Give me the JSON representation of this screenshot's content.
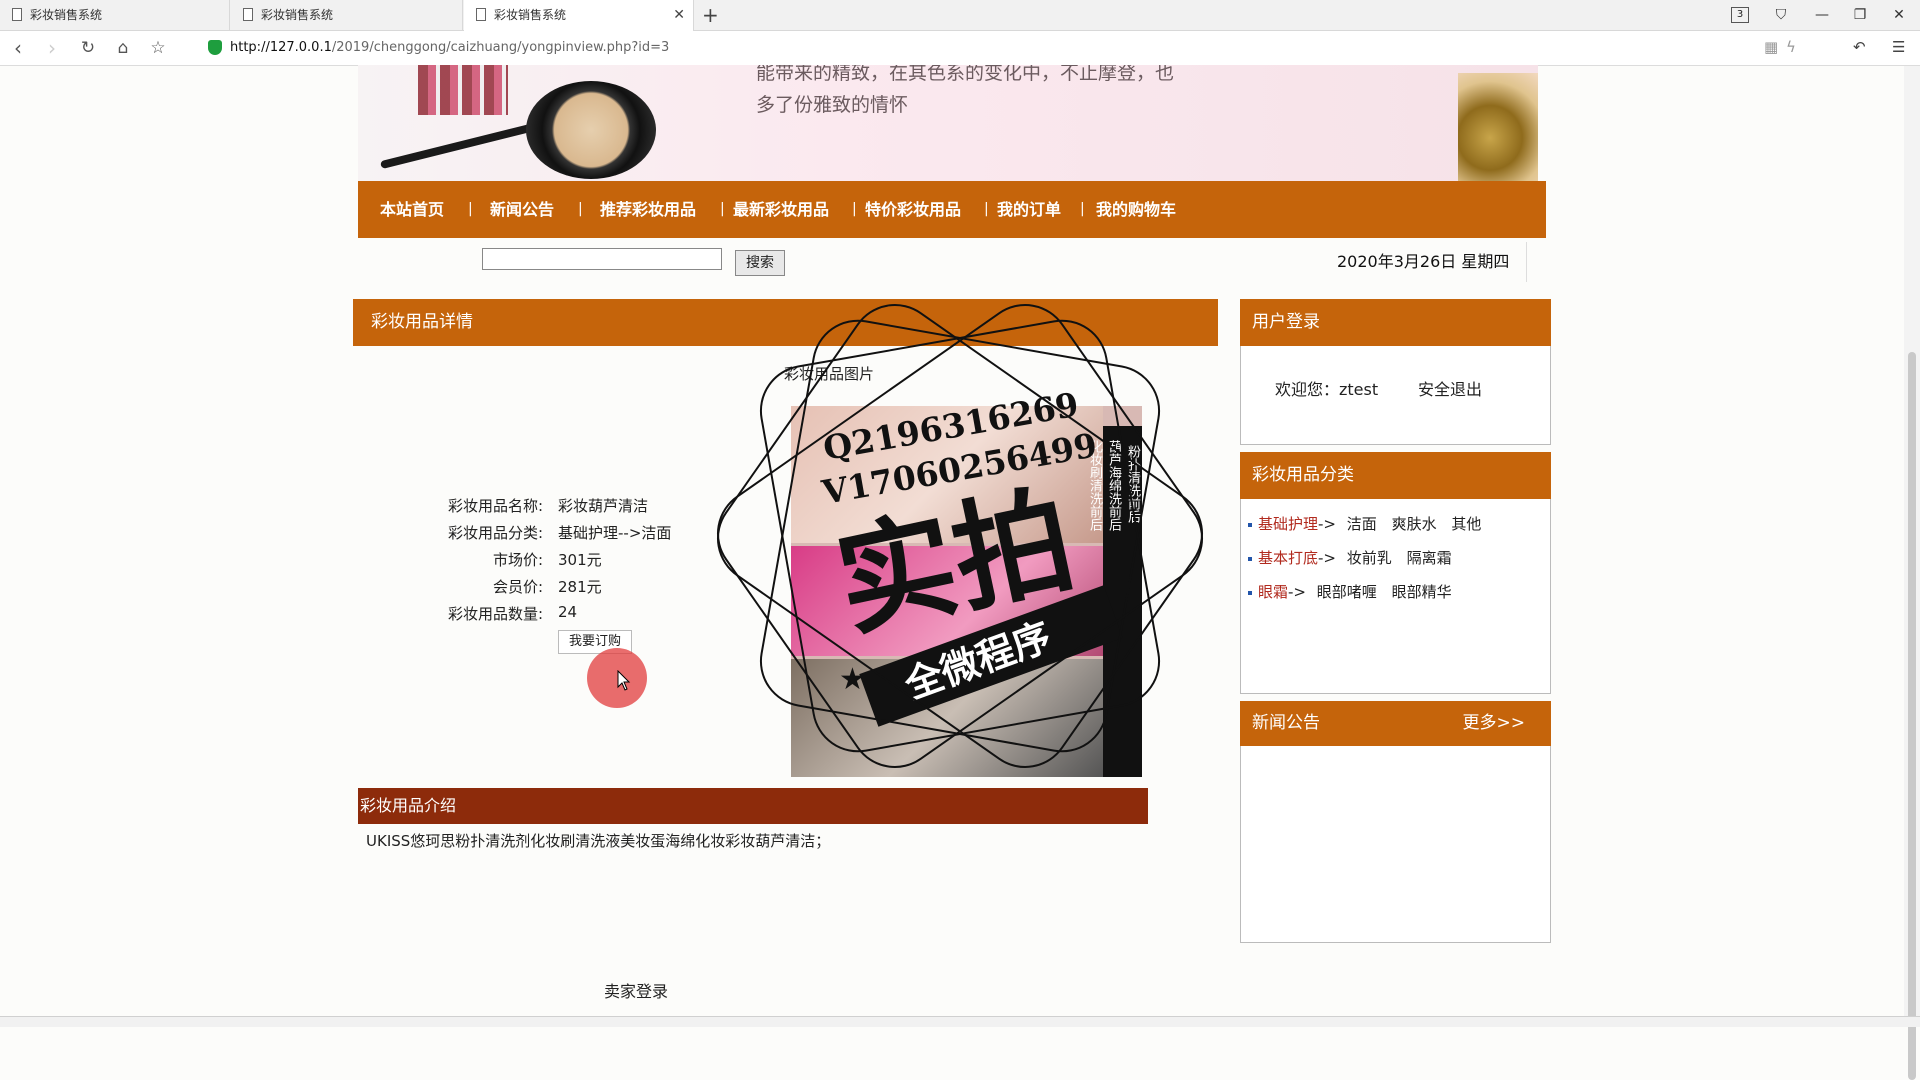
{
  "browser": {
    "tabs": [
      {
        "title": "彩妆销售系统",
        "active": false
      },
      {
        "title": "彩妆销售系统",
        "active": false
      },
      {
        "title": "彩妆销售系统",
        "active": true
      }
    ],
    "tab_count": "3",
    "url_host": "http://127.0.0.1",
    "url_path": "/2019/chenggong/caizhuang/yongpinview.php?id=3"
  },
  "banner": {
    "text_line1": "能带来的精致，在其色系的变化中，不止摩登，也",
    "text_line2": "多了份雅致的情怀"
  },
  "menu": {
    "items": [
      "本站首页",
      "新闻公告",
      "推荐彩妆用品",
      "最新彩妆用品",
      "特价彩妆用品",
      "我的订单",
      "我的购物车"
    ],
    "separator": "|"
  },
  "search": {
    "button": "搜索",
    "value": "",
    "placeholder": ""
  },
  "date": "2020年3月26日 星期四",
  "detail": {
    "heading": "彩妆用品详情",
    "image_label": "彩妆用品图片",
    "labels": [
      "彩妆用品名称:",
      "彩妆用品分类:",
      "市场价:",
      "会员价:",
      "彩妆用品数量:"
    ],
    "values": [
      "彩妆葫芦清洁",
      "基础护理-->洁面",
      "301元",
      "281元",
      "24"
    ],
    "order_button": "我要订购",
    "photo_strip": [
      "粉扑清洗前后",
      "葫芦海绵洗前后",
      "化妆刷清洗前后"
    ],
    "photo_text_big": "实拍",
    "photo_text_banner": "全微程序"
  },
  "watermark": {
    "line1": "Q2196316269",
    "line2": "V17060256499"
  },
  "intro": {
    "heading": "彩妆用品介绍",
    "text": "UKISS悠珂思粉扑清洗剂化妆刷清洗液美妆蛋海绵化妆彩妆葫芦清洁；"
  },
  "login": {
    "heading": "用户登录",
    "welcome": "欢迎您：ztest",
    "logout": "安全退出"
  },
  "categories": {
    "heading": "彩妆用品分类",
    "rows": [
      {
        "main": "基础护理",
        "arrow": "->",
        "subs": [
          "洁面",
          "爽肤水",
          "其他"
        ]
      },
      {
        "main": "基本打底",
        "arrow": "->",
        "subs": [
          "妆前乳",
          "隔离霜"
        ]
      },
      {
        "main": "眼霜",
        "arrow": "->",
        "subs": [
          "眼部啫喱",
          "眼部精华"
        ]
      }
    ]
  },
  "news": {
    "heading": "新闻公告",
    "more": "更多>>"
  },
  "footer": {
    "seller_login": "卖家登录"
  }
}
